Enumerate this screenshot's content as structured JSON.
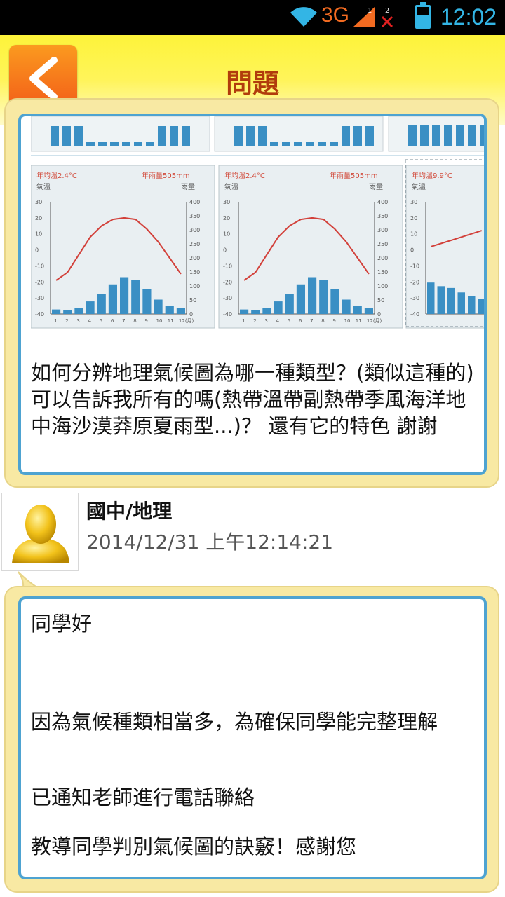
{
  "status_bar": {
    "network": "3G",
    "sim_labels": [
      "1",
      "2"
    ],
    "time": "12:02",
    "icons": [
      "wifi-icon",
      "signal-icon",
      "no-signal-icon",
      "battery-icon"
    ]
  },
  "header": {
    "title": "問題",
    "back_icon": "chevron-left-icon"
  },
  "question": {
    "text": "如何分辨地理氣候圖為哪一種類型？(類似這種的) 可以告訴我所有的嗎(熱帶溫帶副熱帶季風海洋地中海沙漠莽原夏雨型...)？ 還有它的特色 謝謝",
    "image": {
      "panel_left": {
        "temp_label": "年均溫2.4°C",
        "rain_label": "年雨量505mm",
        "temp_axis": "氣溫",
        "rain_axis": "雨量"
      },
      "panel_middle": {
        "temp_label": "年均溫2.4°C",
        "rain_label": "年雨量505mm",
        "temp_axis": "氣溫",
        "rain_axis": "雨量"
      },
      "panel_right": {
        "temp_label": "年均溫9.9°C",
        "temp_axis": "氣溫"
      },
      "months": [
        "1",
        "2",
        "3",
        "4",
        "5",
        "6",
        "7",
        "8",
        "9",
        "10",
        "11",
        "12(月)"
      ],
      "temp_ticks": [
        "30",
        "20",
        "10",
        "0",
        "-10",
        "-20",
        "-30",
        "-40"
      ],
      "rain_ticks": [
        "400",
        "350",
        "300",
        "250",
        "200",
        "150",
        "100",
        "50",
        "0"
      ]
    }
  },
  "answer": {
    "category": "國中/地理",
    "timestamp": "2014/12/31 上午12:14:21",
    "lines": [
      "同學好",
      "因為氣候種類相當多，為確保同學能完整理解",
      "已通知老師進行電話聯絡",
      "教導同學判別氣候圖的訣竅！感謝您"
    ]
  },
  "colors": {
    "header_yellow": "#fff45a",
    "back_orange": "#f25a18",
    "title_brown": "#b13c0c",
    "card_border_blue": "#4ea3d1",
    "card_bg": "#f8e9a3"
  }
}
